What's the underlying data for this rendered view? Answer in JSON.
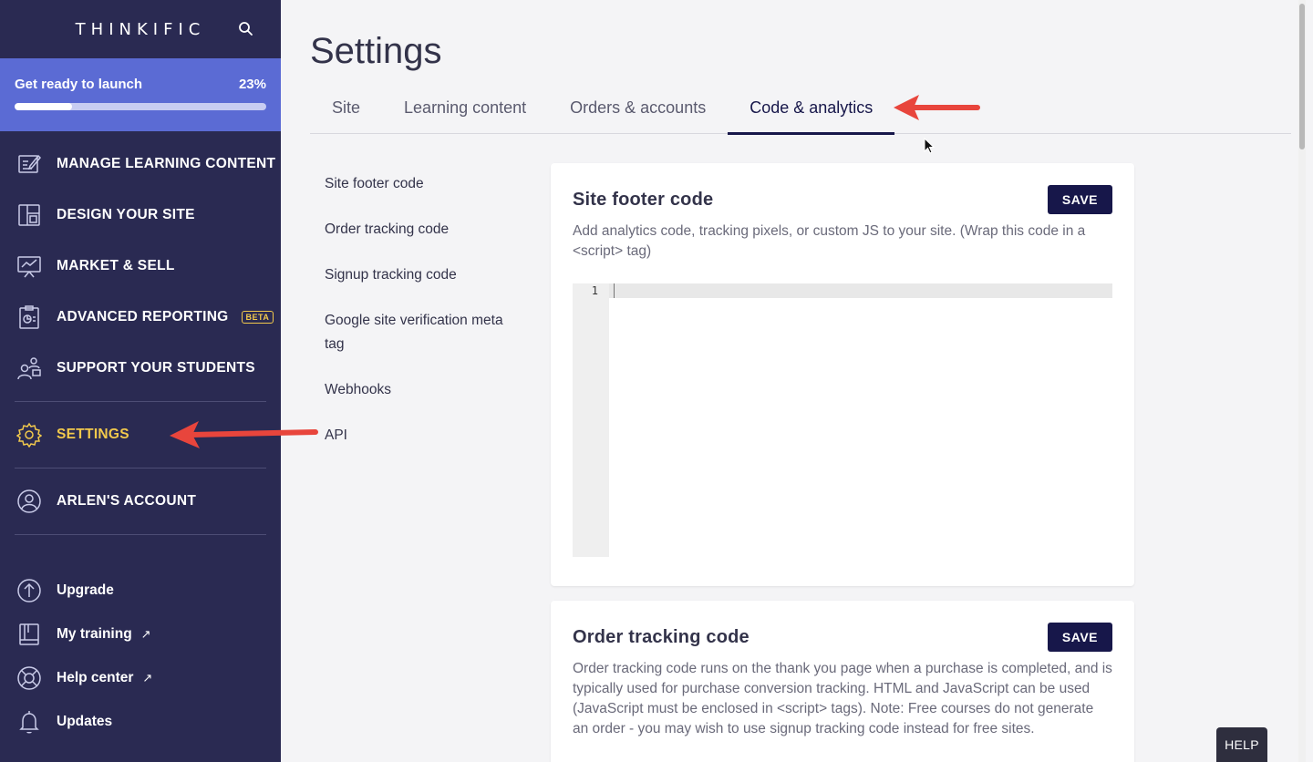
{
  "brand": {
    "logo_text": "THINKIFIC"
  },
  "launch": {
    "label": "Get ready to launch",
    "percent_label": "23%",
    "progress": 0.23
  },
  "nav": {
    "items": [
      {
        "label": "MANAGE LEARNING CONTENT",
        "icon": "edit-icon"
      },
      {
        "label": "DESIGN YOUR SITE",
        "icon": "layout-icon"
      },
      {
        "label": "MARKET & SELL",
        "icon": "presentation-chart-icon"
      },
      {
        "label": "ADVANCED REPORTING",
        "icon": "report-icon",
        "badge": "BETA"
      },
      {
        "label": "SUPPORT YOUR STUDENTS",
        "icon": "users-icon"
      },
      {
        "label": "SETTINGS",
        "icon": "gear-icon",
        "active": true
      },
      {
        "label": "ARLEN'S ACCOUNT",
        "icon": "user-circle-icon"
      }
    ],
    "lower": [
      {
        "label": "Upgrade",
        "icon": "arrow-up-circle-icon"
      },
      {
        "label": "My training",
        "icon": "book-icon",
        "external": "↗"
      },
      {
        "label": "Help center",
        "icon": "lifebuoy-icon",
        "external": "↗"
      },
      {
        "label": "Updates",
        "icon": "bell-icon"
      }
    ]
  },
  "page": {
    "title": "Settings"
  },
  "tabs": [
    {
      "label": "Site"
    },
    {
      "label": "Learning content"
    },
    {
      "label": "Orders & accounts"
    },
    {
      "label": "Code & analytics",
      "active": true
    }
  ],
  "subnav": [
    {
      "label": "Site footer code"
    },
    {
      "label": "Order tracking code"
    },
    {
      "label": "Signup tracking code"
    },
    {
      "label": "Google site verification meta tag"
    },
    {
      "label": "Webhooks"
    },
    {
      "label": "API"
    }
  ],
  "cards": {
    "footer": {
      "title": "Site footer code",
      "save_label": "SAVE",
      "description": "Add analytics code, tracking pixels, or custom JS to your site. (Wrap this code in a <script> tag)",
      "line_number": "1",
      "code_value": ""
    },
    "order": {
      "title": "Order tracking code",
      "save_label": "SAVE",
      "description": "Order tracking code runs on the thank you page when a purchase is completed, and is typically used for purchase conversion tracking. HTML and JavaScript can be used (JavaScript must be enclosed in <script> tags). Note: Free courses do not generate an order - you may wish to use signup tracking code instead for free sites."
    }
  },
  "help": {
    "label": "HELP"
  },
  "colors": {
    "sidebar": "#2a2a52",
    "accent": "#5b6bd4",
    "active_nav": "#f2c94c",
    "primary_button": "#17174a",
    "annotation_arrow": "#e8453c"
  }
}
